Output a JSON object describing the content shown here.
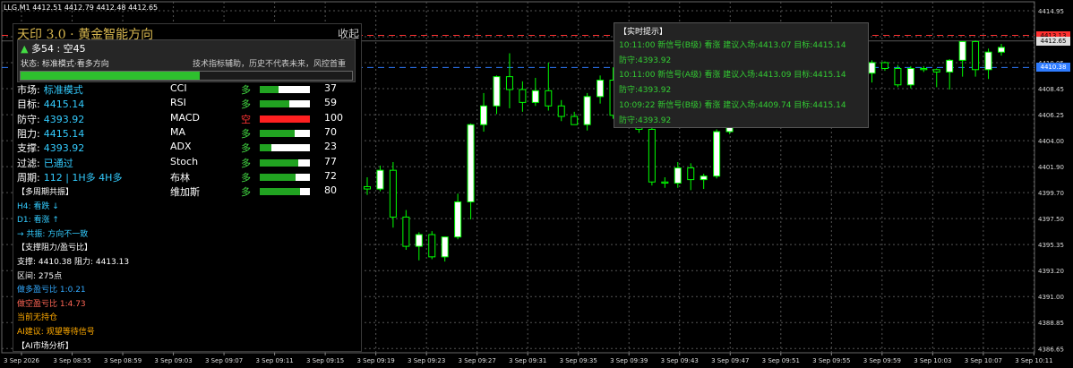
{
  "symbol_header": "LLG,M1  4412.51 4412.79 4412.48 4412.65",
  "panel": {
    "title": "天印 3.0 · 黄金智能方向",
    "collapse_label": "收起",
    "collapse_arrow": "▼",
    "long_short": {
      "arrow": "▲",
      "text": " 多54 : 空45"
    },
    "status": "状态: 标准模式·看多方向",
    "disclaimer": "技术指标辅助，历史不代表未来，风控首重",
    "progress": 0.54,
    "rows": [
      {
        "k": "市场:",
        "v": "标准模式"
      },
      {
        "k": "目标:",
        "v": "4415.14"
      },
      {
        "k": "防守:",
        "v": "4393.92"
      },
      {
        "k": "阻力:",
        "v": "4415.14"
      },
      {
        "k": "支撑:",
        "v": "4393.92"
      },
      {
        "k": "过滤:",
        "v": "已通过"
      },
      {
        "k": "周期:",
        "v": "112 | 1H多 4H多"
      }
    ],
    "indicators": [
      {
        "name": "CCI",
        "dir": "多",
        "value": "37",
        "level": 0.37,
        "bear": false
      },
      {
        "name": "RSI",
        "dir": "多",
        "value": "59",
        "level": 0.59,
        "bear": false
      },
      {
        "name": "MACD",
        "dir": "空",
        "value": "100",
        "level": 1.0,
        "bear": true
      },
      {
        "name": "MA",
        "dir": "多",
        "value": "70",
        "level": 0.7,
        "bear": false
      },
      {
        "name": "ADX",
        "dir": "多",
        "value": "23",
        "level": 0.23,
        "bear": false
      },
      {
        "name": "Stoch",
        "dir": "多",
        "value": "77",
        "level": 0.77,
        "bear": false
      },
      {
        "name": "布林",
        "dir": "多",
        "value": "72",
        "level": 0.72,
        "bear": false
      },
      {
        "name": "维加斯",
        "dir": "多",
        "value": "80",
        "level": 0.8,
        "bear": false
      }
    ],
    "lines": [
      {
        "text": "【多周期共振】",
        "color": "#ffffff"
      },
      {
        "text": "H4: 看跌 ↓",
        "color": "#33ccff"
      },
      {
        "text": "D1: 看涨 ↑",
        "color": "#33ccff"
      },
      {
        "text": "→ 共振: 方向不一致",
        "color": "#33ccff"
      },
      {
        "text": "【支撑阻力/盈亏比】",
        "color": "#ffffff"
      },
      {
        "text": "支撑: 4410.38  阻力: 4413.13",
        "color": "#ffffff"
      },
      {
        "text": "区间: 275点",
        "color": "#ffffff"
      },
      {
        "text": "做多盈亏比 1:0.21",
        "color": "#33aaff"
      },
      {
        "text": "做空盈亏比 1:4.73",
        "color": "#ff6655"
      },
      {
        "text": "当前无持仓",
        "color": "#ffaa00"
      },
      {
        "text": "AI建议: 观望等待信号",
        "color": "#ffaa00"
      },
      {
        "text": "【AI市场分析】",
        "color": "#ffffff"
      }
    ]
  },
  "tooltip": {
    "title": "【实时提示】",
    "lines": [
      {
        "text": "10:11:00 新信号(B级) 看涨 建议入场:4413.07 目标:4415.14",
        "color": "#33cc33"
      },
      {
        "text": "防守:4393.92",
        "color": "#33cc33"
      },
      {
        "text": "10:11:00 新信号(A级) 看涨 建议入场:4413.09 目标:4415.14",
        "color": "#33cc33"
      },
      {
        "text": "防守:4393.92",
        "color": "#33cc33"
      },
      {
        "text": "10:09:22 新信号(B级) 看涨 建议入场:4409.74 目标:4415.14",
        "color": "#33cc33"
      },
      {
        "text": "防守:4393.92",
        "color": "#33cc33"
      }
    ]
  },
  "chart_data": {
    "type": "candlestick",
    "ylim": [
      4386.0,
      4416.0
    ],
    "y_ticks": [
      "4414.95",
      "4412.50",
      "4410.05",
      "4408.45",
      "4406.25",
      "4404.00",
      "4401.90",
      "4399.70",
      "4397.50",
      "4395.35",
      "4393.20",
      "4391.00",
      "4388.85",
      "4386.65"
    ],
    "x_ticks": [
      "3 Sep 2026",
      "3 Sep 08:55",
      "3 Sep 08:59",
      "3 Sep 09:03",
      "3 Sep 09:07",
      "3 Sep 09:11",
      "3 Sep 09:15",
      "3 Sep 09:19",
      "3 Sep 09:23",
      "3 Sep 09:27",
      "3 Sep 09:31",
      "3 Sep 09:35",
      "3 Sep 09:39",
      "3 Sep 09:43",
      "3 Sep 09:47",
      "3 Sep 09:51",
      "3 Sep 09:55",
      "3 Sep 09:59",
      "3 Sep 10:03",
      "3 Sep 10:07",
      "3 Sep 10:11"
    ],
    "red_line": {
      "value": 4413.13,
      "label": "4413.13"
    },
    "blue_line": {
      "value": 4410.38,
      "label": "4410.38"
    },
    "current_price": {
      "value": 4412.65,
      "label": "4412.65"
    },
    "candles": [
      [
        4400.2,
        4401.0,
        4399.5,
        4400.0
      ],
      [
        4400.0,
        4402.0,
        4399.8,
        4401.6
      ],
      [
        4401.6,
        4402.3,
        4396.7,
        4397.6
      ],
      [
        4397.6,
        4398.2,
        4394.8,
        4395.1
      ],
      [
        4395.1,
        4396.3,
        4393.9,
        4396.1
      ],
      [
        4396.1,
        4396.4,
        4394.0,
        4394.2
      ],
      [
        4394.2,
        4395.0,
        4393.8,
        4395.9
      ],
      [
        4395.9,
        4399.6,
        4395.7,
        4398.9
      ],
      [
        4398.9,
        4405.6,
        4397.4,
        4405.5
      ],
      [
        4405.5,
        4408.2,
        4404.9,
        4407.1
      ],
      [
        4407.1,
        4409.7,
        4406.4,
        4409.6
      ],
      [
        4409.6,
        4411.6,
        4406.9,
        4408.5
      ],
      [
        4408.5,
        4409.2,
        4406.6,
        4407.4
      ],
      [
        4407.4,
        4409.5,
        4407.1,
        4408.4
      ],
      [
        4408.4,
        4410.8,
        4406.7,
        4407.1
      ],
      [
        4407.1,
        4407.6,
        4405.8,
        4406.2
      ],
      [
        4406.2,
        4406.6,
        4405.7,
        4405.5
      ],
      [
        4405.5,
        4408.2,
        4405.0,
        4407.9
      ],
      [
        4407.9,
        4409.7,
        4407.3,
        4409.3
      ],
      [
        4409.3,
        4410.4,
        4406.0,
        4406.3
      ],
      [
        4406.3,
        4406.6,
        4405.3,
        4405.5
      ],
      [
        4405.5,
        4405.8,
        4404.8,
        4405.1
      ],
      [
        4405.1,
        4405.4,
        4400.3,
        4400.6
      ],
      [
        4400.6,
        4401.0,
        4400.1,
        4400.5
      ],
      [
        4400.5,
        4402.3,
        4400.1,
        4401.8
      ],
      [
        4401.8,
        4402.2,
        4399.9,
        4400.8
      ],
      [
        4400.8,
        4401.3,
        4400.0,
        4401.1
      ],
      [
        4401.1,
        4405.1,
        4400.9,
        4404.9
      ],
      [
        4404.9,
        4407.6,
        4404.7,
        4407.4
      ],
      [
        4407.4,
        4408.7,
        4405.8,
        4406.2
      ],
      [
        4406.2,
        4407.3,
        4405.9,
        4407.0
      ],
      [
        4407.0,
        4408.4,
        4406.6,
        4408.2
      ],
      [
        4408.2,
        4409.3,
        4406.6,
        4407.6
      ],
      [
        4407.6,
        4408.2,
        4406.4,
        4407.0
      ],
      [
        4407.0,
        4410.0,
        4406.6,
        4409.8
      ],
      [
        4409.8,
        4412.7,
        4409.5,
        4412.5
      ],
      [
        4412.5,
        4414.2,
        4411.9,
        4414.0
      ],
      [
        4414.0,
        4414.1,
        4412.2,
        4412.3
      ],
      [
        4412.3,
        4412.6,
        4409.6,
        4409.9
      ],
      [
        4409.9,
        4411.0,
        4409.1,
        4410.8
      ],
      [
        4410.8,
        4410.9,
        4410.1,
        4410.3
      ],
      [
        4410.3,
        4410.6,
        4408.7,
        4408.9
      ],
      [
        4408.9,
        4410.5,
        4408.6,
        4410.3
      ],
      [
        4410.3,
        4410.5,
        4410.0,
        4410.2
      ],
      [
        4410.2,
        4410.3,
        4408.7,
        4410.0
      ],
      [
        4410.0,
        4411.1,
        4408.5,
        4411.0
      ],
      [
        4411.0,
        4412.6,
        4409.6,
        4412.6
      ],
      [
        4412.6,
        4412.7,
        4409.6,
        4410.2
      ],
      [
        4410.2,
        4412.0,
        4409.4,
        4411.7
      ],
      [
        4411.7,
        4412.4,
        4411.4,
        4412.1
      ]
    ]
  },
  "colors": {
    "bull": "#ffffff",
    "bear": "#000000",
    "wick": "#00ff00",
    "grid": "#555555"
  }
}
